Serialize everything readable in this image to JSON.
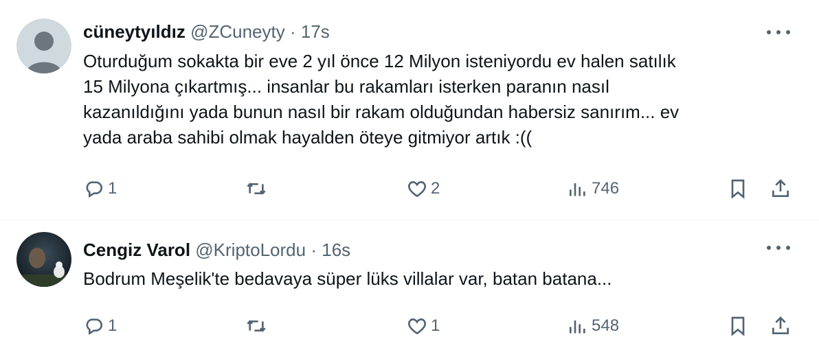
{
  "tweets": [
    {
      "name": "cüneytyıldız",
      "handle": "@ZCuneyty",
      "separator": "·",
      "time": "17s",
      "text_lines": [
        "Oturduğum sokakta bir eve 2 yıl önce 12 Milyon isteniyordu ev halen satılık",
        "15 Milyona çıkartmış... insanlar bu rakamları isterken paranın nasıl",
        "kazanıldığını yada bunun nasıl bir rakam olduğundan habersiz sanırım... ev",
        "yada araba sahibi olmak hayalden öteye gitmiyor artık :(("
      ],
      "replies": "1",
      "retweets": "",
      "likes": "2",
      "views": "746",
      "avatar": "default-avatar"
    },
    {
      "name": "Cengiz Varol",
      "handle": "@KriptoLordu",
      "separator": "·",
      "time": "16s",
      "text_lines": [
        "Bodrum Meşelik'te bedavaya süper lüks villalar var, batan batana..."
      ],
      "replies": "1",
      "retweets": "",
      "likes": "1",
      "views": "548",
      "avatar": "photo-avatar-with-cat"
    }
  ],
  "icons": {
    "reply": "reply-icon",
    "retweet": "retweet-icon",
    "like": "heart-icon",
    "views": "views-icon",
    "bookmark": "bookmark-icon",
    "share": "share-icon",
    "more": "more-icon"
  },
  "colors": {
    "text": "#0f1419",
    "secondary": "#536471",
    "divider": "#eff3f4"
  }
}
